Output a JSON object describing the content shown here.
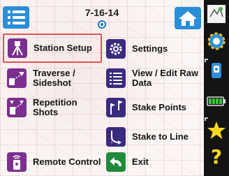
{
  "header": {
    "date": "7-16-14"
  },
  "menu": {
    "station_setup": "Station Setup",
    "settings": "Settings",
    "traverse_line1": "Traverse /",
    "traverse_line2": "Sideshot",
    "view_edit_line1": "View / Edit Raw",
    "view_edit_line2": "Data",
    "repetition_shots": "Repetition Shots",
    "stake_points": "Stake Points",
    "stake_to_line": "Stake to Line",
    "remote_control": "Remote Control",
    "exit": "Exit"
  },
  "status_bar": {
    "help_symbol": "?",
    "icons": [
      "level-bubble-icon",
      "gps-gear-icon",
      "total-station-icon",
      "battery-icon",
      "favorites-star-icon",
      "help-icon"
    ]
  },
  "colors": {
    "accent_blue": "#2a8ed8",
    "selection_border": "#e35353",
    "sidebar_bg": "#141414"
  }
}
